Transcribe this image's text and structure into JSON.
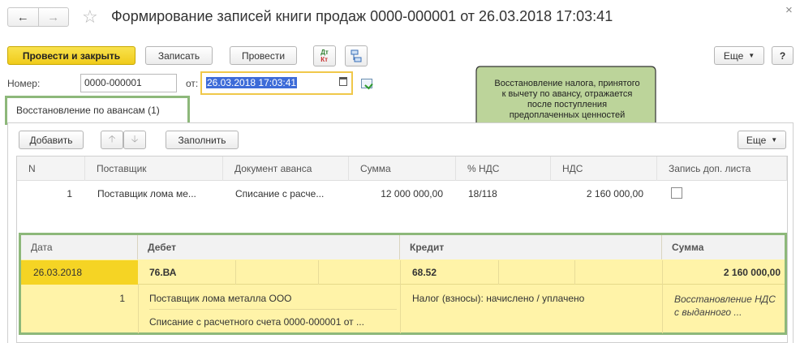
{
  "window": {
    "title": "Формирование записей книги продаж 0000-000001 от 26.03.2018 17:03:41",
    "close": "×"
  },
  "toolbar": {
    "post_and_close": "Провести и закрыть",
    "save": "Записать",
    "post": "Провести",
    "dt_kt_top": "Дт",
    "dt_kt_bottom": "Кт",
    "more": "Еще",
    "help": "?"
  },
  "header": {
    "number_label": "Номер:",
    "number_value": "0000-000001",
    "date_label": "от:",
    "date_value": "26.03.2018 17:03:41"
  },
  "tooltip": {
    "text": "Восстановление налога, принятого к вычету по авансу, отражается после поступления предоплаченных ценностей"
  },
  "tabs": [
    {
      "label": "Восстановление по авансам (1)"
    }
  ],
  "table_toolbar": {
    "add": "Добавить",
    "fill": "Заполнить",
    "more": "Еще"
  },
  "grid": {
    "columns": [
      "N",
      "Поставщик",
      "Документ аванса",
      "Сумма",
      "% НДС",
      "НДС",
      "Запись доп. листа"
    ],
    "rows": [
      {
        "n": "1",
        "supplier": "Поставщик лома ме...",
        "doc": "Списание с расче...",
        "sum": "12 000 000,00",
        "vat_rate": "18/118",
        "vat": "2 160 000,00",
        "extra_sheet": false
      }
    ]
  },
  "entries": {
    "columns": [
      "Дата",
      "Дебет",
      "Кредит",
      "Сумма"
    ],
    "row": {
      "date": "26.03.2018",
      "debit": "76.ВА",
      "credit": "68.52",
      "sum": "2 160 000,00",
      "line_no": "1",
      "debit_sub1": "Поставщик лома металла ООО",
      "debit_sub2": "Списание с расчетного счета 0000-000001 от ...",
      "credit_sub1": "Налог (взносы): начислено / уплачено",
      "comment": "Восстановление НДС с выданного ..."
    }
  },
  "colors": {
    "accent_yellow": "#f5d424",
    "row_yellow": "#fff3a8",
    "highlight_green": "#8db87a",
    "tooltip_fill": "#bcd49a",
    "selection_blue": "#3d6bd8"
  }
}
